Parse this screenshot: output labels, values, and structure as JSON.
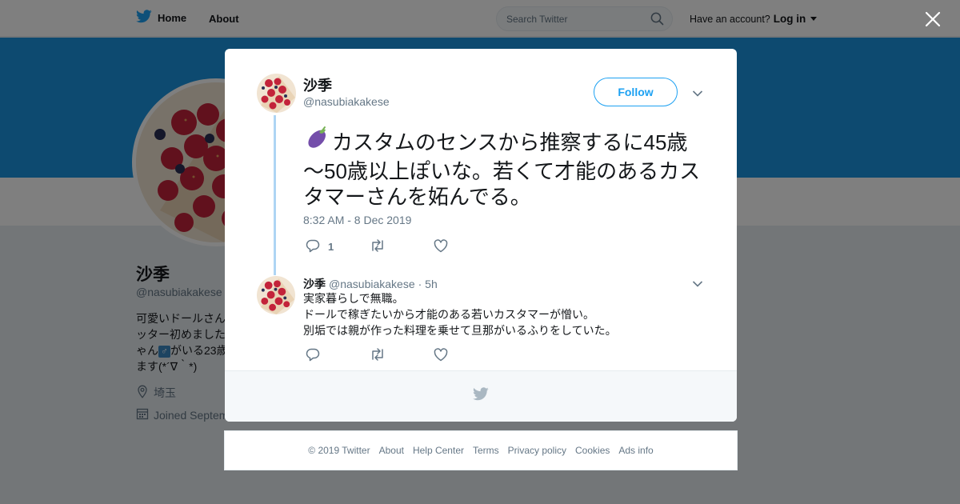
{
  "topbar": {
    "home_label": "Home",
    "about_label": "About",
    "search_placeholder": "Search Twitter",
    "account_prompt": "Have an account?",
    "login_label": "Log in"
  },
  "profile": {
    "name": "沙季",
    "handle": "@nasubiakakese",
    "bio_lines": [
      "可愛いドールさん",
      "ッター初めました",
      "ゃん",
      "がいる23歳",
      "ます(*´∇｀*)"
    ],
    "gender_symbol": "♂",
    "location": "埼玉",
    "joined": "Joined Septem"
  },
  "tweet": {
    "author_name": "沙季",
    "author_handle": "@nasubiakakese",
    "follow_label": "Follow",
    "emoji": "🍆",
    "text": "カスタムのセンスから推察するに45歳～50歳以上ぽいな。若くて才能のあるカスタマーさんを妬んでる。",
    "timestamp": "8:32 AM - 8 Dec 2019",
    "reply_count": "1"
  },
  "reply": {
    "author_name": "沙季",
    "author_handle": "@nasubiakakese",
    "age": "· 5h",
    "lines": [
      "実家暮らしで無職。",
      "ドールで稼ぎたいから才能のある若いカスタマーが憎い。",
      "別垢では親が作った料理を乗せて旦那がいるふりをしていた。"
    ]
  },
  "footer": {
    "copyright": "© 2019 Twitter",
    "links": [
      "About",
      "Help Center",
      "Terms",
      "Privacy policy",
      "Cookies",
      "Ads info"
    ]
  },
  "colors": {
    "twitter_blue": "#1da1f2",
    "banner_blue": "#1b95e0",
    "thread_line": "#aed5f4",
    "muted_text": "#657786"
  }
}
